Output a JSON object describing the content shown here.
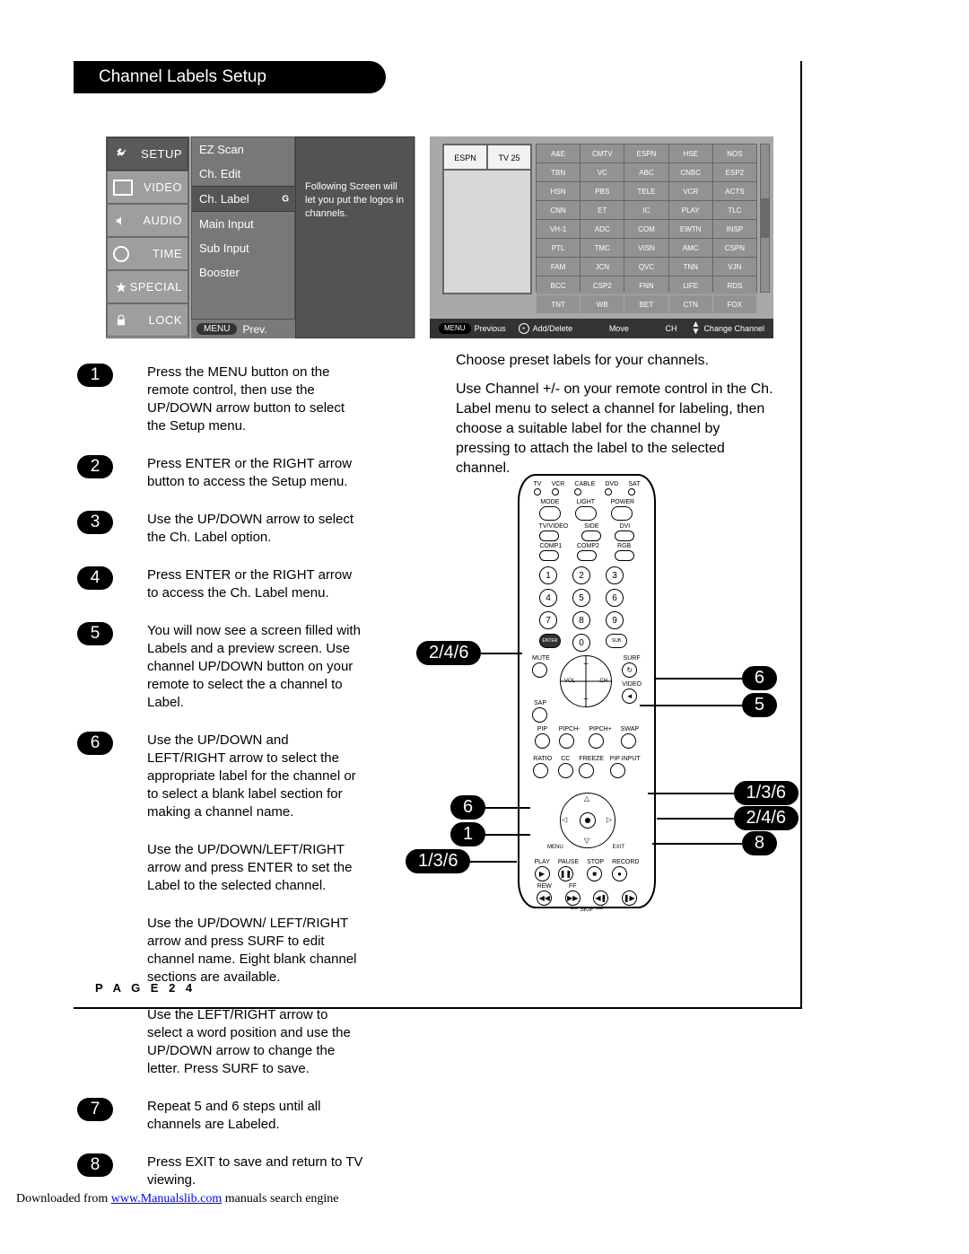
{
  "title": "Channel Labels Setup",
  "page_label": "P A G E   2 4",
  "download": {
    "prefix": "Downloaded from ",
    "link_text": "www.Manualslib.com",
    "suffix": " manuals search engine"
  },
  "setup_menu": {
    "left_items": [
      {
        "label": "SETUP",
        "selected": true
      },
      {
        "label": "VIDEO"
      },
      {
        "label": "AUDIO"
      },
      {
        "label": "TIME"
      },
      {
        "label": "SPECIAL"
      },
      {
        "label": "LOCK"
      }
    ],
    "mid_items": [
      {
        "label": "EZ Scan"
      },
      {
        "label": "Ch. Edit"
      },
      {
        "label": "Ch. Label",
        "selected": true,
        "mark": "G"
      },
      {
        "label": "Main Input"
      },
      {
        "label": "Sub Input"
      },
      {
        "label": "Booster"
      }
    ],
    "right_text": "Following Screen will let you put the logos in channels.",
    "prev_bar": {
      "menu": "MENU",
      "prev": "Prev."
    }
  },
  "labels_screen": {
    "preview_espn": "ESPN",
    "preview_tv25": "TV 25",
    "grid": [
      [
        "A&E",
        "CMTV",
        "ESPN",
        "HSE",
        "NOS"
      ],
      [
        "TBN",
        "VC",
        "ABC",
        "CNBC",
        "ESP2"
      ],
      [
        "HSN",
        "PBS",
        "TELE",
        "VCR",
        "ACTS"
      ],
      [
        "CNN",
        "ET",
        "IC",
        "PLAY",
        "TLC"
      ],
      [
        "VH-1",
        "ADC",
        "COM",
        "EWTN",
        "INSP"
      ],
      [
        "PTL",
        "TMC",
        "VISN",
        "AMC",
        "CSPN"
      ],
      [
        "FAM",
        "JCN",
        "QVC",
        "TNN",
        "VJN"
      ],
      [
        "BCC",
        "CSP2",
        "FNN",
        "LIFE",
        "RDS"
      ],
      [
        "TNT",
        "WB",
        "BET",
        "CTN",
        "FOX"
      ]
    ],
    "bar": {
      "menu": "MENU",
      "previous": "Previous",
      "add_delete": "Add/Delete",
      "move": "Move",
      "ch_change": "Change Channel",
      "ch": "CH"
    }
  },
  "right_paras": {
    "p1": "Choose preset labels for your channels.",
    "p2": "Use Channel +/- on your remote control in the Ch. Label menu to select a channel for labeling, then choose a suitable label for the channel by pressing     to attach the label to the selected channel."
  },
  "steps": [
    {
      "n": "1",
      "text": "Press the MENU button on the remote control, then use the UP/DOWN arrow button to select the Setup menu."
    },
    {
      "n": "2",
      "text": "Press ENTER or the RIGHT arrow button to access the Setup menu."
    },
    {
      "n": "3",
      "text": "Use the UP/DOWN arrow to select the Ch. Label option."
    },
    {
      "n": "4",
      "text": "Press ENTER or the RIGHT arrow to access the Ch. Label menu."
    },
    {
      "n": "5",
      "text": "You will now see a screen filled with Labels and a preview screen. Use channel UP/DOWN button on your remote to select the a channel to Label."
    },
    {
      "n": "6",
      "text": "Use the UP/DOWN and LEFT/RIGHT arrow to select the appropriate label for the channel or to select  a blank label section for making a channel name."
    },
    {
      "n": "",
      "text": "Use the UP/DOWN/LEFT/RIGHT arrow and press ENTER to set the Label to the selected channel."
    },
    {
      "n": "",
      "text": "Use the UP/DOWN/ LEFT/RIGHT arrow and press SURF to edit channel name. Eight blank channel sections are available."
    },
    {
      "n": "",
      "text": "Use the LEFT/RIGHT arrow to select a word position and use the UP/DOWN arrow to change the letter. Press SURF to save."
    },
    {
      "n": "7",
      "text": "Repeat 5 and 6 steps until all channels are Labeled."
    },
    {
      "n": "8",
      "text": "Press EXIT to save and return to TV viewing."
    }
  ],
  "remote": {
    "mode_row": [
      "TV",
      "VCR",
      "CABLE",
      "DVD",
      "SAT"
    ],
    "row2": [
      "MODE",
      "LIGHT",
      "POWER"
    ],
    "row3": [
      "TV/VIDEO",
      "SIDE",
      "DVI"
    ],
    "row4": [
      "COMP1",
      "COMP2",
      "RGB"
    ],
    "digits": [
      "1",
      "2",
      "3",
      "4",
      "5",
      "6",
      "7",
      "8",
      "9",
      "",
      "0",
      ""
    ],
    "enter": "ENTER",
    "sub": "SUB",
    "mute": "MUTE",
    "surf": "SURF",
    "sap": "SAP",
    "video": "VIDEO",
    "vol": "VOL",
    "ch": "CH",
    "pip_row": [
      "PIP",
      "PIPCH-",
      "PIPCH+",
      "SWAP"
    ],
    "small_row": [
      "RATIO",
      "CC",
      "FREEZE",
      "PIP INPUT"
    ],
    "menu": "MENU",
    "exit": "EXIT",
    "play_row": [
      "PLAY",
      "PAUSE",
      "STOP",
      "RECORD"
    ],
    "rew_ff": [
      "REW",
      "FF"
    ],
    "skip": "SKIP"
  },
  "callouts": {
    "left": [
      {
        "label": "2/4/6"
      },
      {
        "label": "6"
      },
      {
        "label": "1"
      },
      {
        "label": "1/3/6"
      }
    ],
    "right": [
      {
        "label": "6"
      },
      {
        "label": "5"
      },
      {
        "label": "1/3/6"
      },
      {
        "label": "2/4/6"
      },
      {
        "label": "8"
      }
    ]
  }
}
